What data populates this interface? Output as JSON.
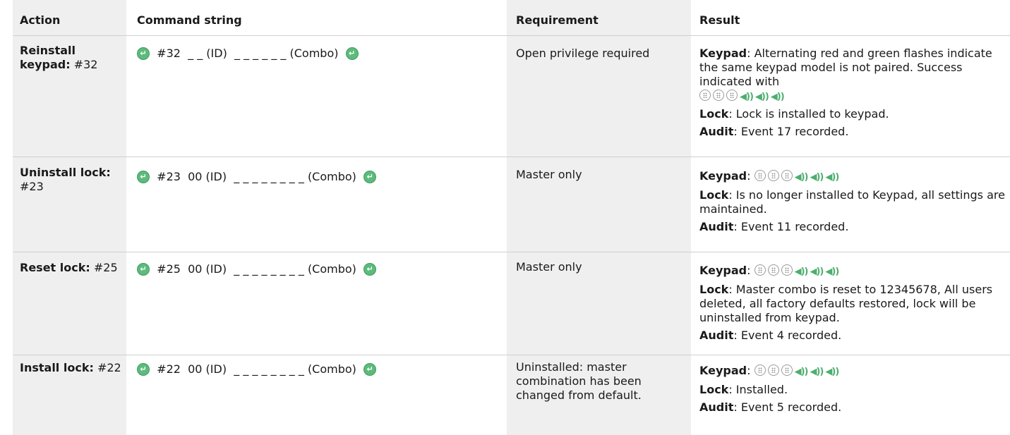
{
  "headers": {
    "action": "Action",
    "command": "Command string",
    "requirement": "Requirement",
    "result": "Result"
  },
  "rows": [
    {
      "action_bold": "Reinstall keypad:",
      "action_code": " #32",
      "command": "#32  _ _ (ID)  _ _ _ _ _ _ (Combo)",
      "requirement": "Open privilege required",
      "keypad_label": "Keypad",
      "keypad_text": ": Alternating red and green flashes indicate the same keypad model is not paired. Success indicated with",
      "lock_label": "Lock",
      "lock_text": ":  Lock is installed to keypad.",
      "audit_label": "Audit",
      "audit_text": ": Event 17 recorded."
    },
    {
      "action_bold": "Uninstall lock:",
      "action_code": " #23",
      "command": "#23  00 (ID)  _ _ _ _ _ _ _ _ (Combo)",
      "requirement": "Master only",
      "keypad_label": "Keypad",
      "keypad_text": ":",
      "lock_label": "Lock",
      "lock_text": ": Is no longer installed to Keypad, all settings are maintained.",
      "audit_label": "Audit",
      "audit_text": ": Event 11 recorded."
    },
    {
      "action_bold": "Reset lock:",
      "action_code": " #25",
      "command": "#25  00 (ID)  _ _ _ _ _ _ _ _ (Combo)",
      "requirement": "Master only",
      "keypad_label": "Keypad",
      "keypad_text": ":",
      "lock_label": "Lock",
      "lock_text": ": Master combo is reset to 12345678, All users deleted, all factory defaults restored, lock will be uninstalled from keypad.",
      "audit_label": "Audit",
      "audit_text": ": Event 4 recorded."
    },
    {
      "action_bold": "Install lock:",
      "action_code": " #22",
      "command": "#22  00 (ID)  _ _ _ _ _ _ _ _ (Combo)",
      "requirement": "Uninstalled: master combination has been changed from default.",
      "keypad_label": "Keypad",
      "keypad_text": ":",
      "lock_label": "Lock",
      "lock_text": ": Installed.",
      "audit_label": "Audit",
      "audit_text": ": Event 5 recorded."
    }
  ],
  "icons": {
    "enter_key": "enter-key-icon",
    "keypad_button": "keypad-button-icon",
    "beep": "beep-icon",
    "accent_color": "#5dbb7c"
  }
}
